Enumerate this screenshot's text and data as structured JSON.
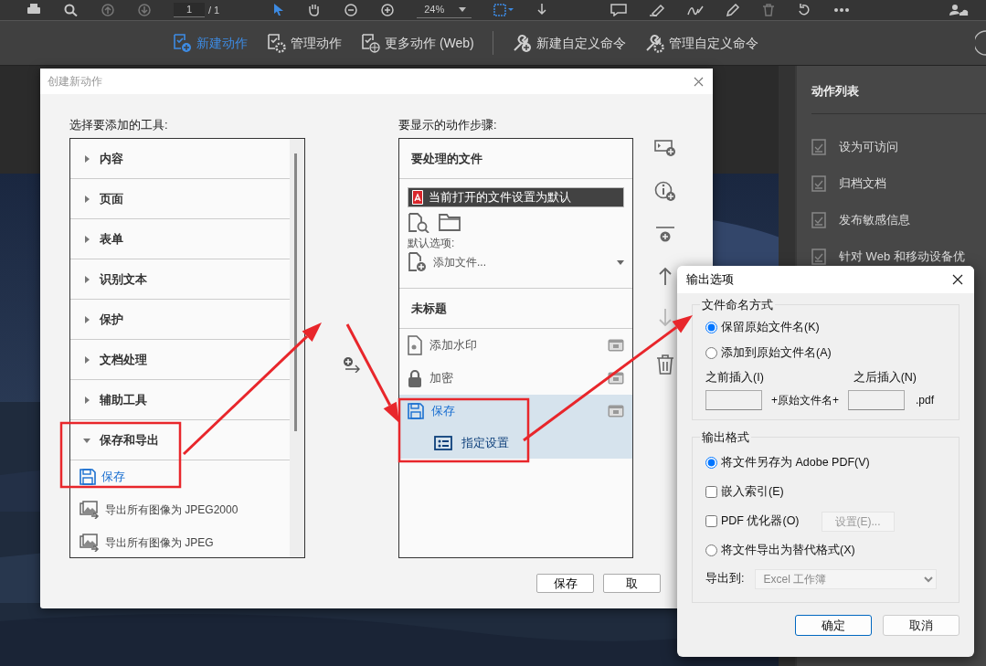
{
  "toolbar": {
    "page_value": "1",
    "page_total": "/ 1",
    "zoom": "24%"
  },
  "action_tabs": [
    {
      "label": "新建动作",
      "kind": "new",
      "selected": true
    },
    {
      "label": "管理动作",
      "kind": "manage",
      "selected": false
    },
    {
      "label": "更多动作 (Web)",
      "kind": "web",
      "selected": false
    },
    {
      "label": "新建自定义命令",
      "kind": "new-command",
      "selected": false
    },
    {
      "label": "管理自定义命令",
      "kind": "manage-command",
      "selected": false
    }
  ],
  "action_list": {
    "title": "动作列表",
    "items": [
      "设为可访问",
      "归档文档",
      "发布敏感信息",
      "针对 Web 和移动设备优"
    ]
  },
  "new_action_dialog": {
    "title": "创建新动作",
    "tools_label": "选择要添加的工具:",
    "tools": [
      {
        "label": "内容",
        "expanded": false
      },
      {
        "label": "页面",
        "expanded": false
      },
      {
        "label": "表单",
        "expanded": false
      },
      {
        "label": "识别文本",
        "expanded": false
      },
      {
        "label": "保护",
        "expanded": false
      },
      {
        "label": "文档处理",
        "expanded": false
      },
      {
        "label": "辅助工具",
        "expanded": false
      },
      {
        "label": "保存和导出",
        "expanded": true,
        "children": [
          {
            "label": "保存",
            "kind": "save",
            "selected": true
          },
          {
            "label": "导出所有图像为 JPEG2000",
            "kind": "export-image",
            "selected": false
          },
          {
            "label": "导出所有图像为 JPEG",
            "kind": "export-image",
            "selected": false
          }
        ]
      }
    ],
    "steps_label": "要显示的动作步骤:",
    "files_section": {
      "title": "要处理的文件",
      "current_file": "当前打开的文件设置为默认",
      "default_label": "默认选项:",
      "add_files": "添加文件..."
    },
    "steps_title": "未标题",
    "steps": [
      {
        "label": "添加水印",
        "kind": "watermark",
        "selected": false
      },
      {
        "label": "加密",
        "kind": "lock",
        "selected": false
      },
      {
        "label": "保存",
        "kind": "save",
        "selected": true,
        "children": [
          {
            "label": "指定设置",
            "kind": "settings"
          }
        ]
      }
    ],
    "buttons": [
      "保存",
      "取"
    ]
  },
  "output_dialog": {
    "title": "输出选项",
    "naming": {
      "title": "文件命名方式",
      "options": [
        {
          "label": "保留原始文件名(K)",
          "selected": true
        },
        {
          "label": "添加到原始文件名(A)",
          "selected": false
        }
      ],
      "before_label": "之前插入(I)",
      "after_label": "之后插入(N)",
      "middle": "+原始文件名+",
      "extension": ".pdf"
    },
    "format": {
      "title": "输出格式",
      "options": [
        {
          "kind": "radio",
          "label": "将文件另存为 Adobe PDF(V)",
          "selected": true
        },
        {
          "kind": "checkbox",
          "label": "嵌入索引(E)",
          "checked": false
        },
        {
          "kind": "checkbox",
          "label": "PDF 优化器(O)",
          "checked": false,
          "button": "设置(E)...",
          "button_disabled": true
        },
        {
          "kind": "radio",
          "label": "将文件导出为替代格式(X)",
          "selected": false
        }
      ],
      "export_label": "导出到:",
      "export_value": "Excel 工作簿",
      "export_disabled": true
    },
    "buttons": [
      {
        "label": "确定",
        "primary": true
      },
      {
        "label": "取消",
        "primary": false
      }
    ]
  }
}
